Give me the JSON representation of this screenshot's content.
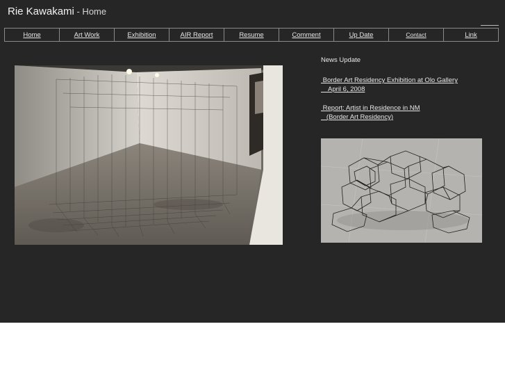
{
  "header": {
    "title": "Rie Kawakami",
    "subtitle": " - Home"
  },
  "nav": {
    "items": [
      {
        "label": "Home"
      },
      {
        "label": "Art Work"
      },
      {
        "label": "Exhibition"
      },
      {
        "label": "AIR Report"
      },
      {
        "label": "Resume"
      },
      {
        "label": "Comment"
      },
      {
        "label": "Up Date"
      },
      {
        "label": "Contact"
      },
      {
        "label": "Link"
      }
    ]
  },
  "news": {
    "heading": "News Update",
    "items": [
      {
        "line1": " Border Art Residency Exhibition at Olo Gallery",
        "line2": "    April 6, 2008"
      },
      {
        "line1": " Report: Artist in Residence in NM",
        "line2": "   (Border Art Residency)"
      }
    ]
  },
  "images": {
    "main_photo": "gallery-installation-photo",
    "side_photo": "wire-sculpture-photo"
  }
}
